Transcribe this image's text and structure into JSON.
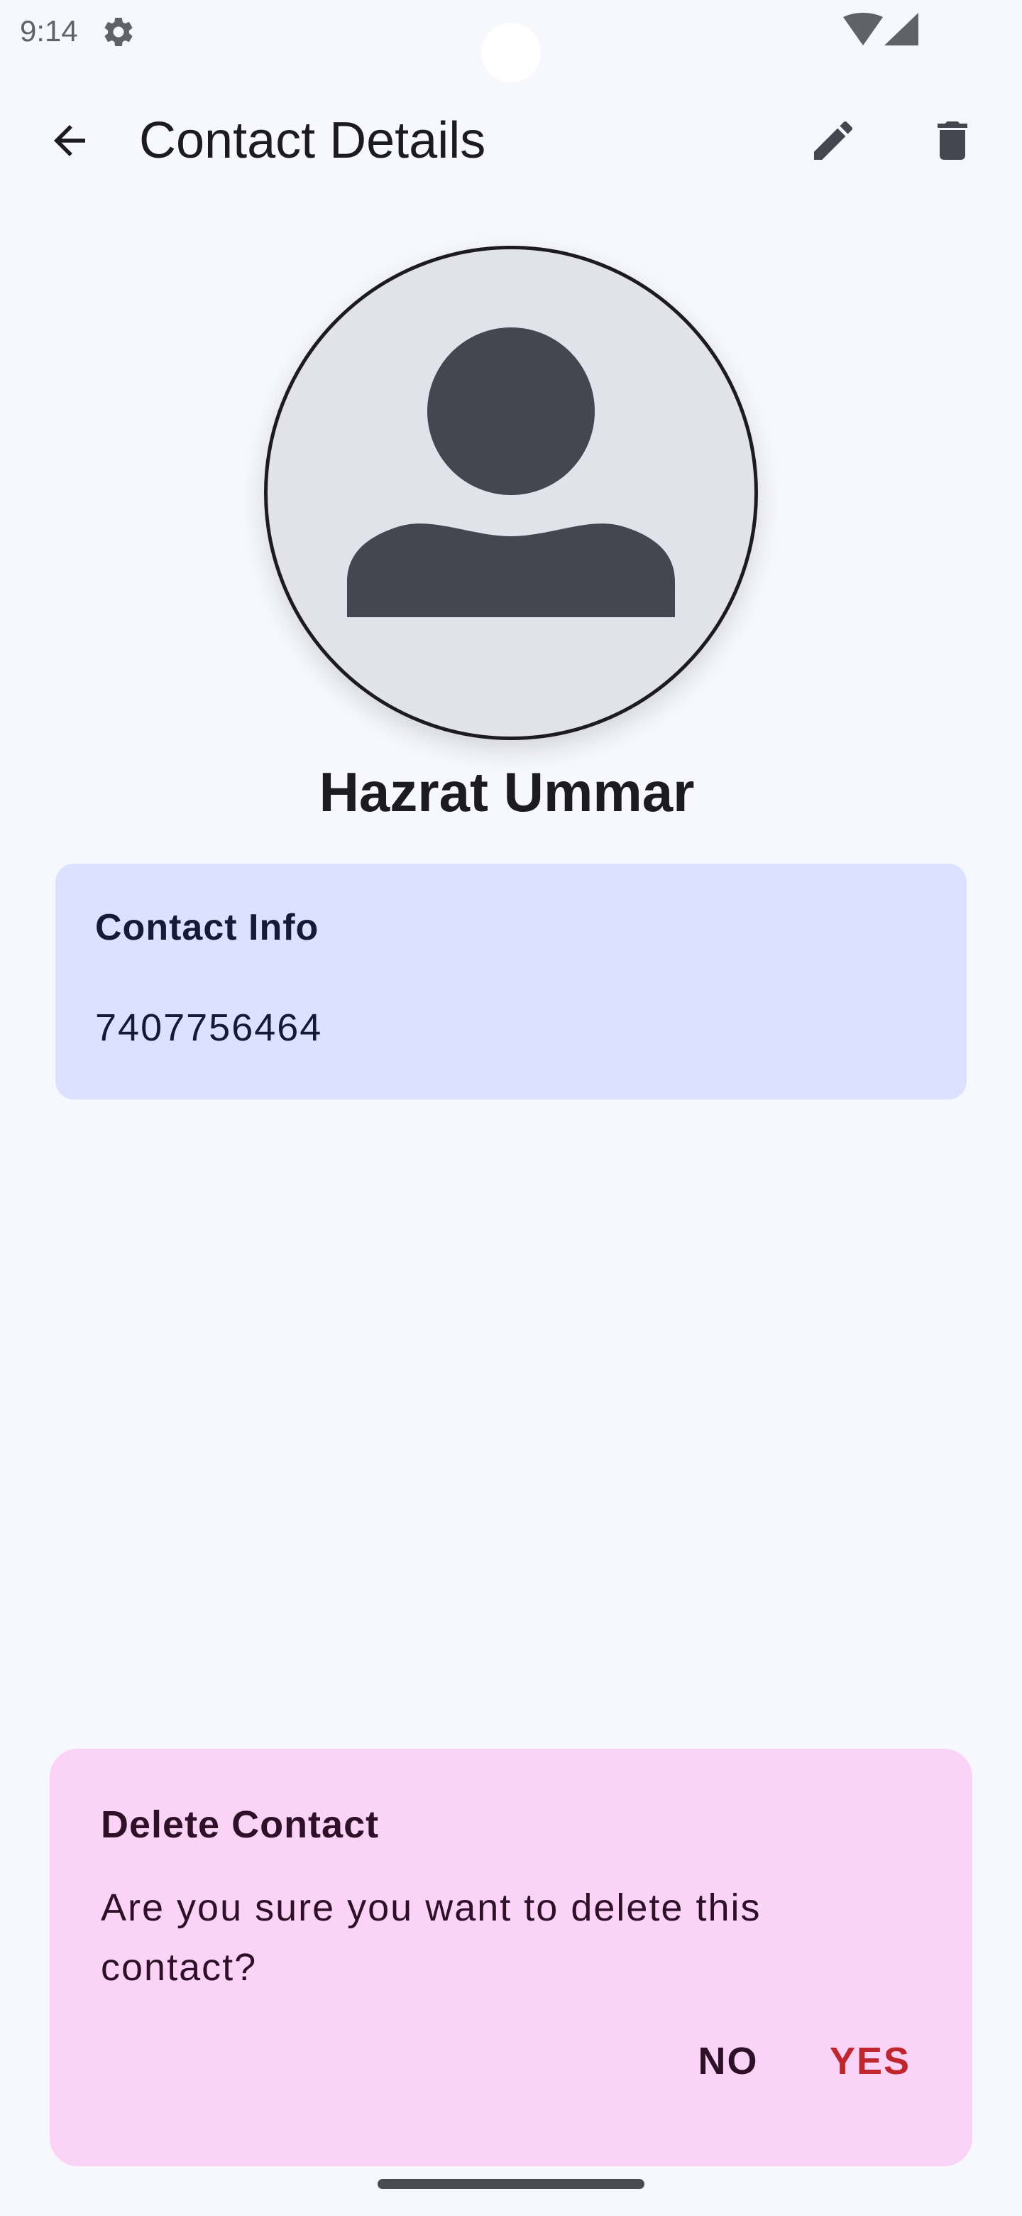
{
  "status_bar": {
    "time": "9:14",
    "icons": [
      "gear-icon",
      "wifi-icon",
      "signal-icon"
    ]
  },
  "app_bar": {
    "title": "Contact Details",
    "back_icon": "arrow-back-icon",
    "edit_icon": "pencil-icon",
    "delete_icon": "trash-icon"
  },
  "contact": {
    "avatar_icon": "person-icon",
    "name": "Hazrat Ummar"
  },
  "info_card": {
    "heading": "Contact Info",
    "phone": "7407756464"
  },
  "dialog": {
    "title": "Delete Contact",
    "message": "Are you sure you want to delete this contact?",
    "no_label": "NO",
    "yes_label": "YES"
  },
  "colors": {
    "background": "#f7f8fd",
    "info_card": "#dbe1fe",
    "dialog": "#fbd3f7",
    "destructive": "#c0262d",
    "avatar_bg": "#e2e2ea",
    "icon": "#45464f"
  }
}
